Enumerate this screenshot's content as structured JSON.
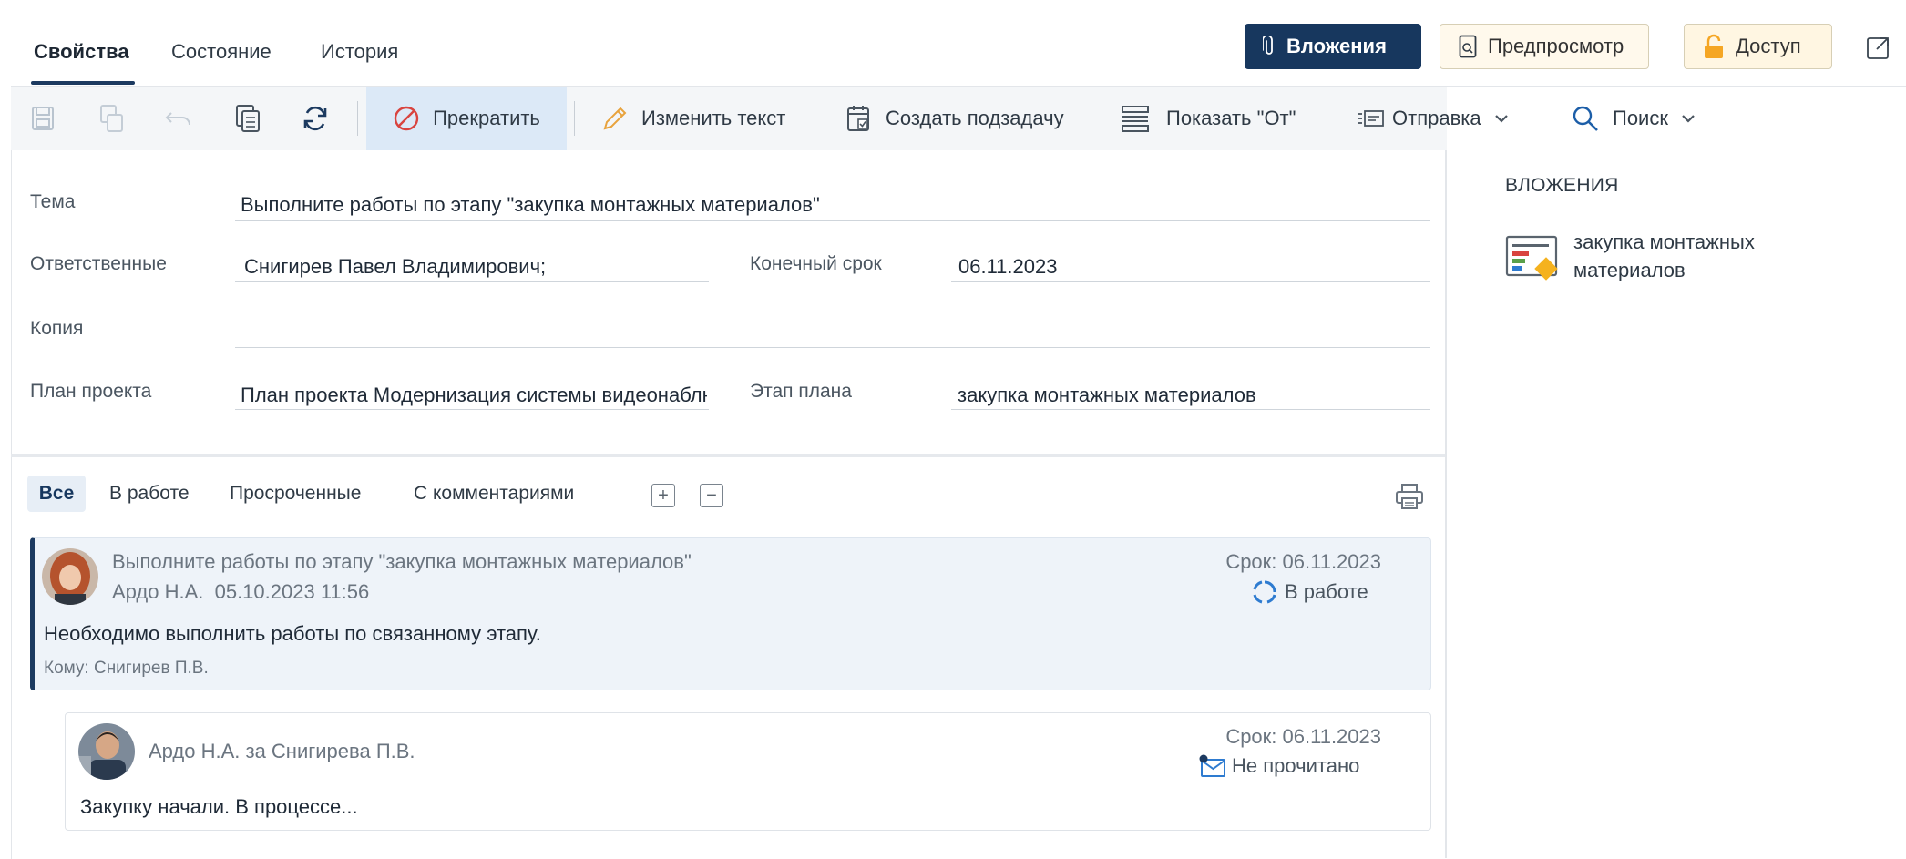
{
  "tabs": [
    {
      "label": "Свойства",
      "active": true
    },
    {
      "label": "Состояние",
      "active": false
    },
    {
      "label": "История",
      "active": false
    }
  ],
  "top_buttons": {
    "attachments": "Вложения",
    "preview": "Предпросмотр",
    "access": "Доступ"
  },
  "toolbar": {
    "stop": "Прекратить",
    "edit_text": "Изменить текст",
    "create_subtask": "Создать подзадачу",
    "show_from": "Показать \"От\"",
    "send": "Отправка",
    "search": "Поиск"
  },
  "form": {
    "subject_label": "Тема",
    "subject_value": "Выполните работы по этапу \"закупка монтажных материалов\"",
    "responsible_label": "Ответственные",
    "responsible_value": "Снигирев Павел Владимирович;",
    "deadline_label": "Конечный срок",
    "deadline_value": "06.11.2023",
    "copy_label": "Копия",
    "copy_value": "",
    "project_plan_label": "План проекта",
    "project_plan_value": "План проекта Модернизация системы видеонаблюдения",
    "plan_stage_label": "Этап плана",
    "plan_stage_value": "закупка монтажных материалов"
  },
  "filters": [
    "Все",
    "В работе",
    "Просроченные",
    "С комментариями"
  ],
  "tasks": [
    {
      "title": "Выполните работы по этапу \"закупка монтажных материалов\"",
      "meta": "Ардо Н.А.  05.10.2023 11:56",
      "due": "Срок: 06.11.2023",
      "status": "В работе",
      "body": "Необходимо выполнить работы по связанному этапу.",
      "to": "Кому: Снигирев П.В."
    },
    {
      "title": "Ардо Н.А. за Снигирева П.В.",
      "due": "Срок: 06.11.2023",
      "status": "Не прочитано",
      "body": "Закупку начали. В процессе..."
    }
  ],
  "sidebar": {
    "title": "ВЛОЖЕНИЯ",
    "attachment_name": "закупка монтажных материалов"
  },
  "colors": {
    "accent": "#17375e",
    "active_stop_bg": "#dce9f7",
    "stop_red": "#d9443f",
    "warn_orange": "#f5a623"
  }
}
